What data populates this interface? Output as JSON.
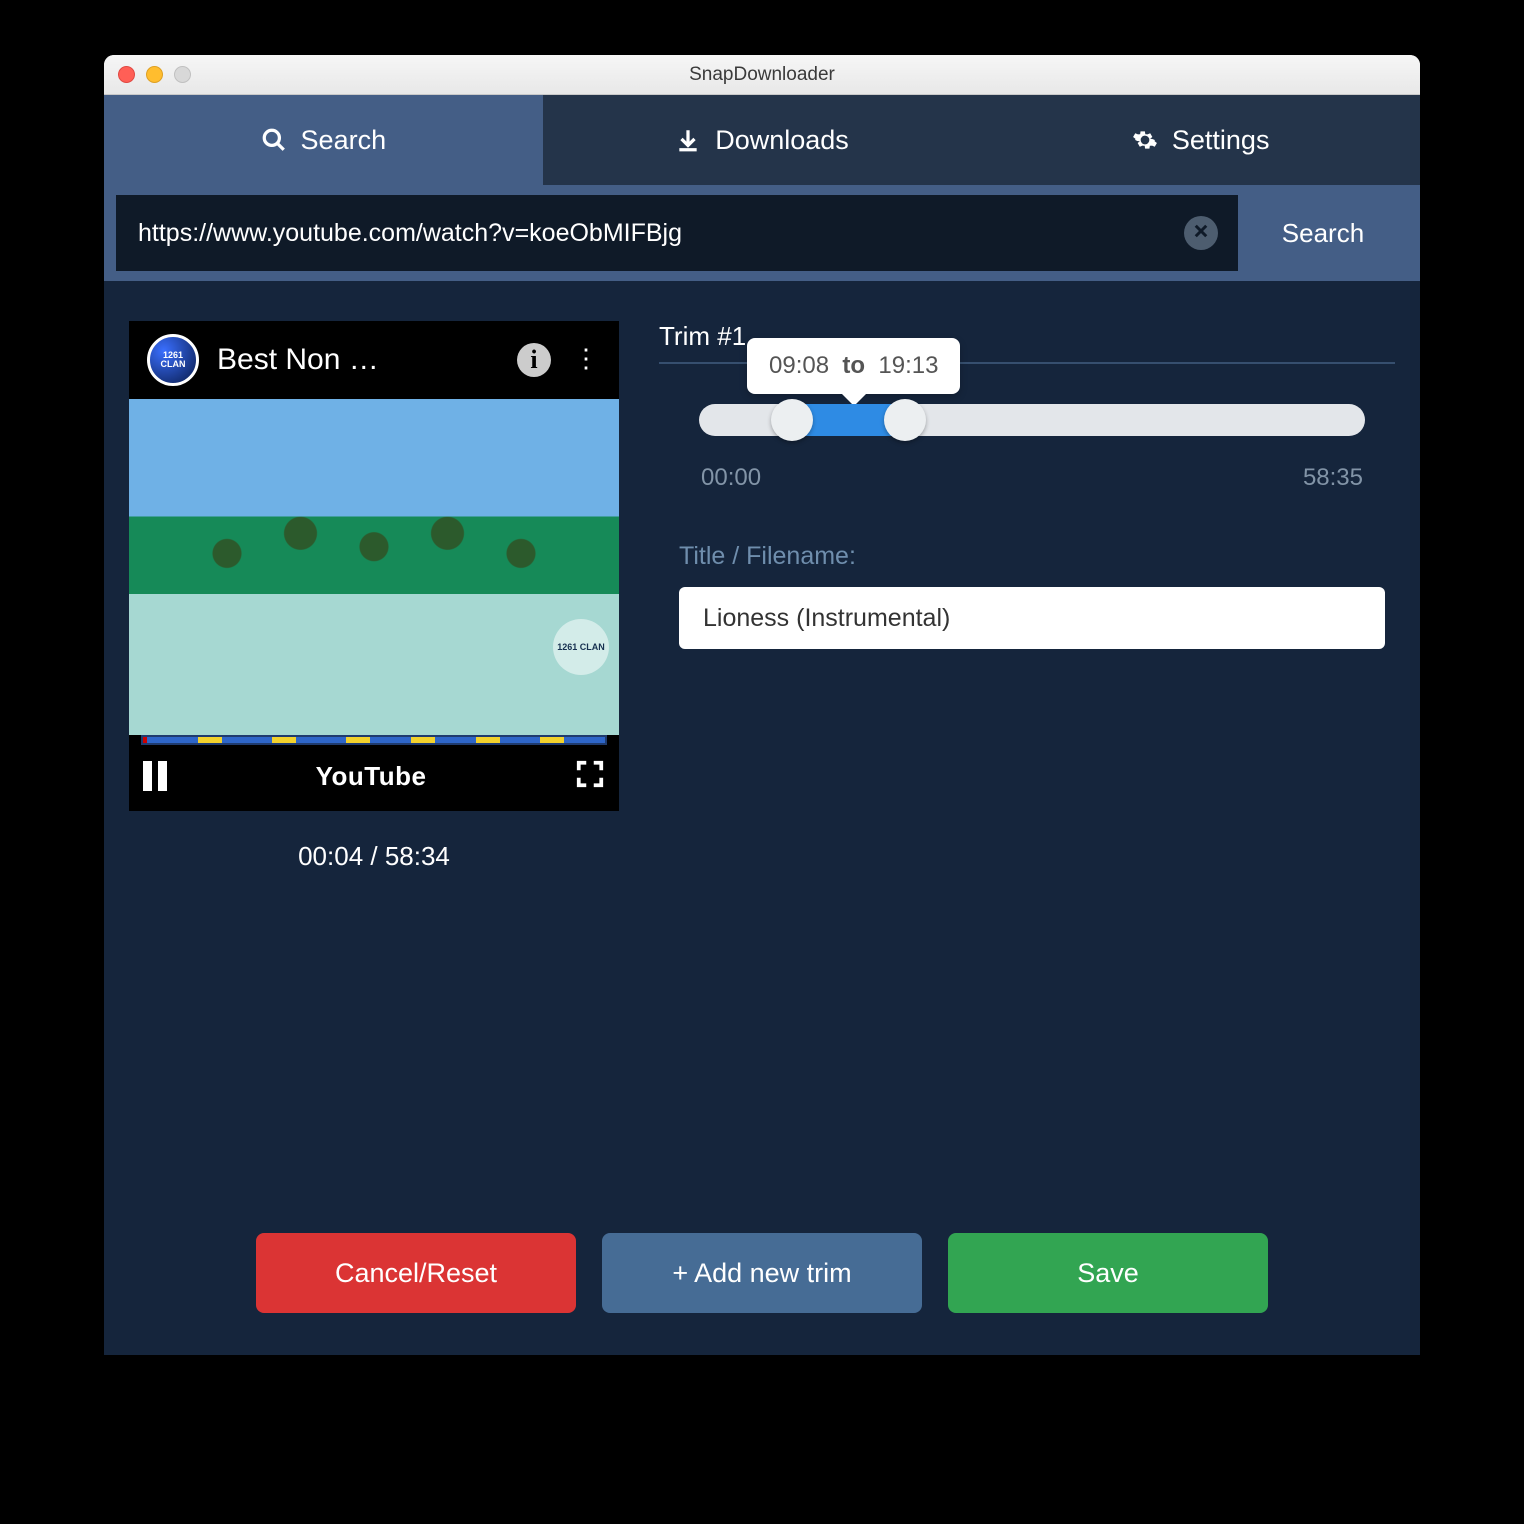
{
  "window": {
    "title": "SnapDownloader"
  },
  "tabs": {
    "search": "Search",
    "downloads": "Downloads",
    "settings": "Settings",
    "active": "search"
  },
  "search": {
    "url": "https://www.youtube.com/watch?v=koeObMIFBjg",
    "button": "Search"
  },
  "preview": {
    "channel_badge": "1261 CLAN",
    "video_title": "Best Non …",
    "player_brand": "YouTube",
    "time_display": "00:04 / 58:34",
    "watermark": "1261 CLAN"
  },
  "trim": {
    "heading": "Trim #1",
    "from": "09:08",
    "to_word": "to",
    "to": "19:13",
    "range_start": "00:00",
    "range_end": "58:35",
    "filename_label": "Title / Filename:",
    "filename": "Lioness (Instrumental)"
  },
  "buttons": {
    "cancel": "Cancel/Reset",
    "addtrim": "+ Add new trim",
    "save": "Save"
  }
}
